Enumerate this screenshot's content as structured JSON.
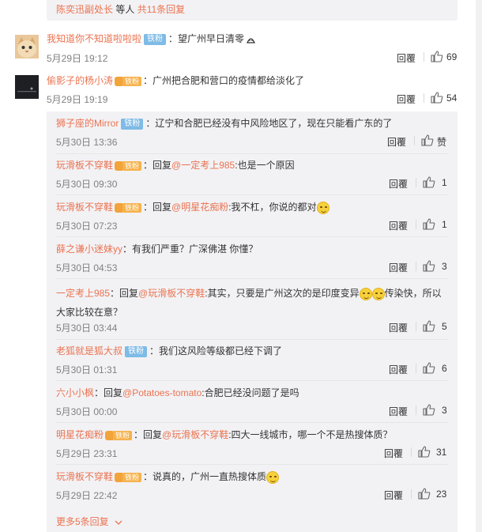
{
  "top_thread": {
    "users": "陈奕迅副处长",
    "suffix": " 等人",
    "count_link": "共11条回复"
  },
  "comments": [
    {
      "user": "我知道你不知道啦啦啦",
      "badge": "铁粉",
      "text": "：望广州早日清零",
      "time": "5月29日 19:12",
      "reply": "回覆",
      "likes": "69"
    },
    {
      "user": "偷影子的杨小涛",
      "badge": "铁粉",
      "text": "：广州把合肥和营口的疫情都给淡化了",
      "time": "5月29日 19:19",
      "reply": "回覆",
      "likes": "54"
    }
  ],
  "subreplies": [
    {
      "user": "狮子座的Mirror",
      "badge": "铁粉",
      "text": "：辽宁和合肥已经没有中风险地区了，现在只能看广东的了",
      "time": "5月30日 13:36",
      "reply": "回覆",
      "likes": "赞"
    },
    {
      "user": "玩滑板不穿鞋",
      "badge": "铁粉",
      "pre": "：回复",
      "at": "@一定考上985",
      "text": ":也是一个原因",
      "time": "5月30日 09:30",
      "reply": "回覆",
      "likes": "1"
    },
    {
      "user": "玩滑板不穿鞋",
      "badge": "铁粉",
      "pre": "：回复",
      "at": "@明星花痴粉",
      "text": ":我不杠，你说的都对",
      "time": "5月30日 07:23",
      "reply": "回覆",
      "likes": "1"
    },
    {
      "user": "薛之谦小迷妹yy",
      "badge": "",
      "text": "：有我们严重？广深佛湛 你懂？",
      "time": "5月30日 04:53",
      "reply": "回覆",
      "likes": "3"
    },
    {
      "user": "一定考上985",
      "badge": "",
      "pre": "：回复",
      "at": "@玩滑板不穿鞋",
      "text": ":其实，只要是广州这次的是印度变异",
      "text2": "传染快，所以大家比较在意？",
      "time": "5月30日 03:44",
      "reply": "回覆",
      "likes": "5"
    },
    {
      "user": "老狐就是狐大叔",
      "badge": "铁粉",
      "text": "：我们这风险等级都已经下调了",
      "time": "5月30日 01:31",
      "reply": "回覆",
      "likes": "6"
    },
    {
      "user": "六小小枫",
      "badge": "",
      "pre": "：回复",
      "at": "@Potatoes-tomato",
      "text": ":合肥已经没问题了是吗",
      "time": "5月30日 00:00",
      "reply": "回覆",
      "likes": "3"
    },
    {
      "user": "明星花痴粉",
      "badge": "铁粉",
      "pre": "：回复",
      "at": "@玩滑板不穿鞋",
      "text": ":四大一线城市，哪一个不是热搜体质？",
      "time": "5月29日 23:31",
      "reply": "回覆",
      "likes": "31"
    },
    {
      "user": "玩滑板不穿鞋",
      "badge": "铁粉",
      "text": "：说真的，广州一直热搜体质",
      "time": "5月29日 22:42",
      "reply": "回覆",
      "likes": "23"
    }
  ],
  "more_link": "更多5条回复",
  "colors": {
    "accent": "#eb7350",
    "panel": "#f2f2f5",
    "badge_blue": "#7ebbe6",
    "badge_orange": "#f6b24b"
  }
}
